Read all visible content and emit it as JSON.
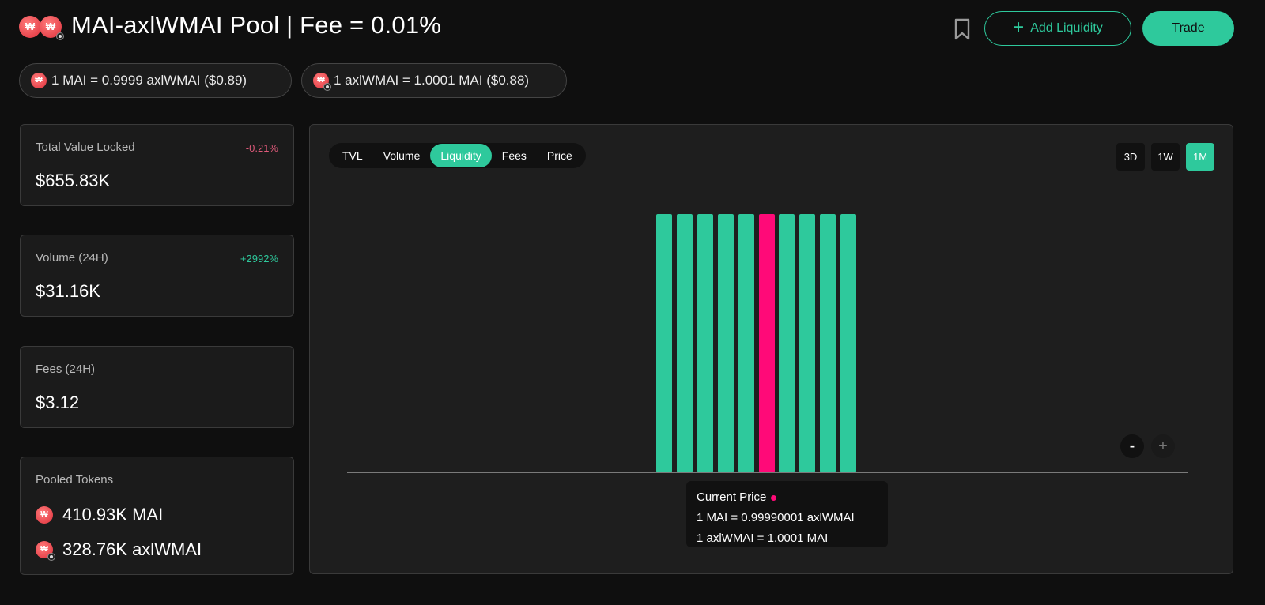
{
  "header": {
    "title": "MAI-axlWMAI Pool | Fee = 0.01%",
    "token_icon_glyph": "₩",
    "add_liquidity_label": "Add Liquidity",
    "trade_label": "Trade",
    "bookmark_icon": "bookmark-icon"
  },
  "prices": {
    "pill1": "1 MAI = 0.9999 axlWMAI ($0.89)",
    "pill2": "1 axlWMAI = 1.0001 MAI ($0.88)"
  },
  "stats": {
    "tvl": {
      "label": "Total Value Locked",
      "value": "$655.83K",
      "change": "-0.21%"
    },
    "volume": {
      "label": "Volume (24H)",
      "value": "$31.16K",
      "change": "+2992%"
    },
    "fees": {
      "label": "Fees (24H)",
      "value": "$3.12"
    },
    "pooled": {
      "label": "Pooled Tokens",
      "token1": "410.93K MAI",
      "token2": "328.76K axlWMAI"
    }
  },
  "chart": {
    "tabs": [
      "TVL",
      "Volume",
      "Liquidity",
      "Fees",
      "Price"
    ],
    "active_tab": "Liquidity",
    "ranges": [
      "3D",
      "1W",
      "1M"
    ],
    "active_range": "1M",
    "zoom_out_label": "-",
    "zoom_in_label": "+",
    "tooltip": {
      "title": "Current Price",
      "line1": "1 MAI = 0.99990001 axlWMAI",
      "line2": "1 axlWMAI = 1.0001 MAI"
    }
  },
  "chart_data": {
    "type": "bar",
    "bar_count": 10,
    "values": [
      1,
      1,
      1,
      1,
      1,
      1,
      1,
      1,
      1,
      1
    ],
    "current_price_index": 5,
    "colors": {
      "default": "#2ec99c",
      "current": "#ff0a78"
    }
  },
  "colors": {
    "accent": "#2ec99c",
    "negative": "#e05a7a",
    "current_price": "#ff0a78",
    "background": "#0f0f0f"
  }
}
